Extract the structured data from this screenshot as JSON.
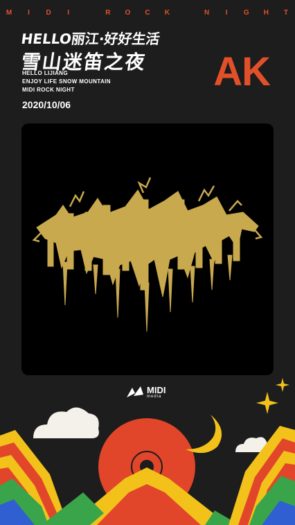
{
  "banner": {
    "letters": [
      "M",
      "I",
      "D",
      "I",
      "R",
      "O",
      "C",
      "K",
      "N",
      "I",
      "G",
      "H",
      "T"
    ]
  },
  "header": {
    "title_line1": "HELLO丽江·好好生活",
    "title_line2": "雪山迷笛之夜",
    "sub_line1": "HELLO LIJIANG",
    "sub_line2": "ENJOY LIFE SNOW MOUNTAIN",
    "sub_line3": "MIDI ROCK NIGHT",
    "date": "2020/10/06"
  },
  "artist": {
    "name": "AK"
  },
  "logo": {
    "word": "MIDI",
    "sub": "media"
  },
  "colors": {
    "background": "#1d1d1d",
    "accent": "#e2502a",
    "gold": "#c9a94e",
    "yellow": "#f2c21b",
    "red": "#e2462a",
    "green": "#3aa44a",
    "blue": "#2f5fd0"
  },
  "icons": [
    "band-logo-image",
    "midi-logo-icon",
    "sparkle-icon",
    "cloud-icon",
    "moon-icon",
    "sun-icon"
  ]
}
